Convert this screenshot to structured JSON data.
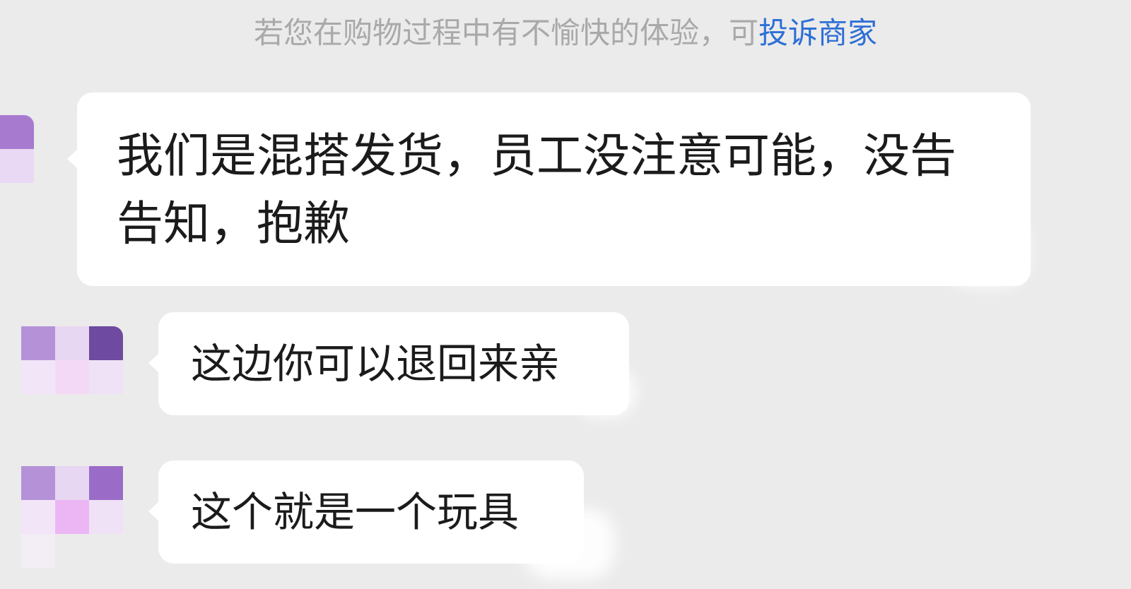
{
  "notice": {
    "text": "若您在购物过程中有不愉快的体验，可",
    "link": "投诉商家"
  },
  "messages": [
    {
      "text": "我们是混搭发货，员工没注意可能，没告告知，抱歉"
    },
    {
      "text": "这边你可以退回来亲"
    },
    {
      "text": "这个就是一个玩具"
    }
  ],
  "colors": {
    "background": "#ebebeb",
    "bubble": "#ffffff",
    "notice_text": "#a9a9a9",
    "link": "#2e6fd6"
  }
}
